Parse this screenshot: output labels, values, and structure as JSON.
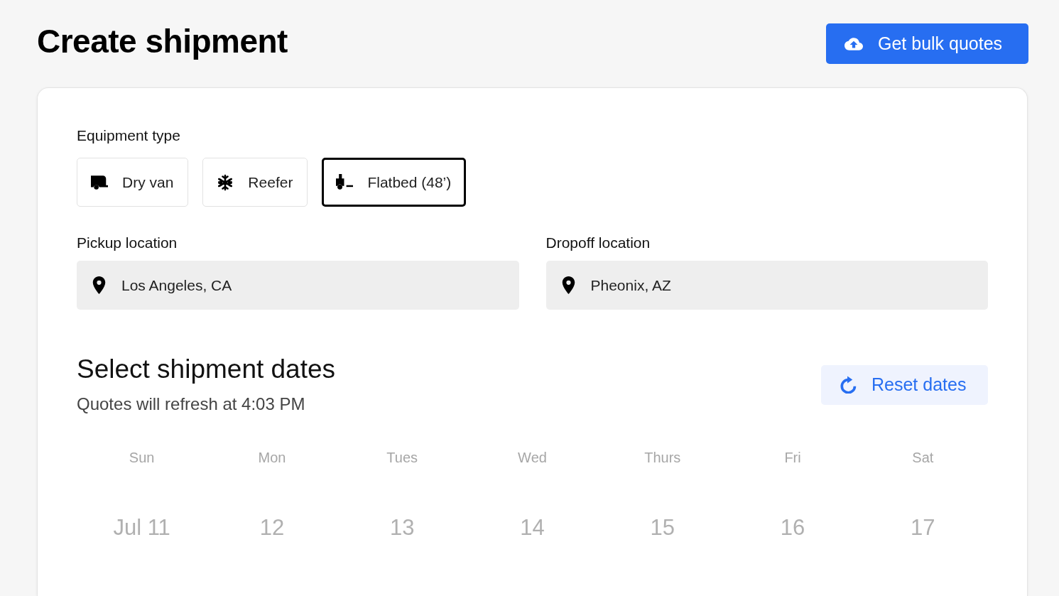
{
  "header": {
    "title": "Create shipment",
    "bulk_button": {
      "label": "Get bulk quotes"
    }
  },
  "equipment": {
    "label": "Equipment type",
    "options": [
      {
        "kind": "van",
        "label": "Dry van",
        "selected": false
      },
      {
        "kind": "reefer",
        "label": "Reefer",
        "selected": false
      },
      {
        "kind": "flatbed",
        "label": "Flatbed (48’)",
        "selected": true
      }
    ]
  },
  "locations": [
    {
      "label": "Pickup location",
      "value": "Los Angeles, CA"
    },
    {
      "label": "Dropoff location",
      "value": "Pheonix, AZ"
    }
  ],
  "dates": {
    "title": "Select shipment dates",
    "subtitle": "Quotes will refresh at 4:03 PM",
    "reset_button": {
      "label": "Reset dates"
    },
    "weekdays": [
      "Sun",
      "Mon",
      "Tues",
      "Wed",
      "Thurs",
      "Fri",
      "Sat"
    ],
    "days": [
      {
        "label": "Jul 11",
        "disabled": true
      },
      {
        "label": "12",
        "disabled": true
      },
      {
        "label": "13",
        "disabled": true
      },
      {
        "label": "14",
        "disabled": true
      },
      {
        "label": "15",
        "disabled": true
      },
      {
        "label": "16",
        "disabled": true
      },
      {
        "label": "17",
        "disabled": true
      }
    ]
  }
}
